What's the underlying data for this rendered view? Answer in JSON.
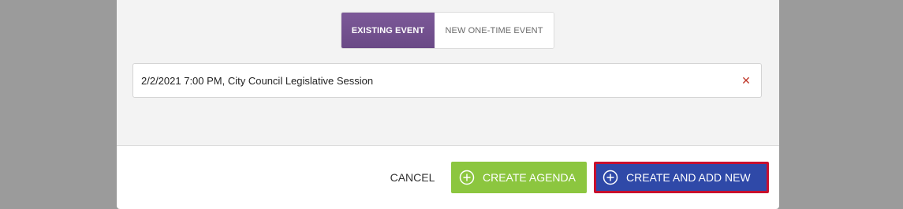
{
  "modal": {
    "event_type_toggle": {
      "existing_label": "EXISTING EVENT",
      "new_label": "NEW ONE-TIME EVENT",
      "selected": "EXISTING EVENT"
    },
    "event_field": {
      "value": "2/2/2021 7:00 PM, City Council Legislative Session",
      "clear_icon": "close-icon"
    },
    "footer": {
      "cancel_label": "CANCEL",
      "create_agenda_label": "CREATE AGENDA",
      "create_and_add_new_label": "CREATE AND ADD NEW",
      "button_icon": "plus-circle-icon"
    }
  },
  "colors": {
    "backdrop": "#9b9b9b",
    "toggle_active": "#6f4e8c",
    "create_agenda_green": "#8cc63f",
    "create_add_blue": "#2f49a8",
    "focus_outline": "#c8102e",
    "clear_icon": "#c0392b"
  }
}
